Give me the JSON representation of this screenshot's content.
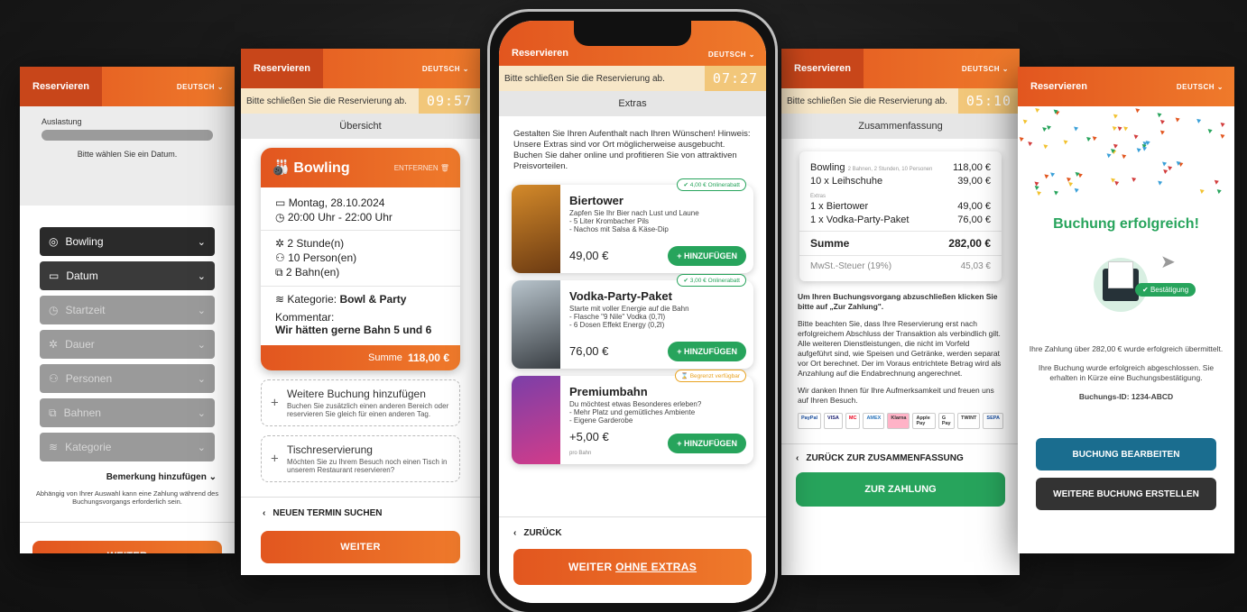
{
  "common": {
    "tab_label": "Reservieren",
    "language": "DEUTSCH",
    "timer_message": "Bitte schließen Sie die Reservierung ab."
  },
  "screen1": {
    "utilization_label": "Auslastung",
    "utilization_hint": "Bitte wählen Sie ein Datum.",
    "selects": [
      "Bowling",
      "Datum",
      "Startzeit",
      "Dauer",
      "Personen",
      "Bahnen",
      "Kategorie"
    ],
    "remark": "Bemerkung hinzufügen",
    "note": "Abhängig von Ihrer Auswahl kann eine Zahlung während des Buchungsvorgangs erforderlich sein.",
    "next": "WEITER"
  },
  "screen2": {
    "timer": "09:57",
    "section": "Übersicht",
    "card_title": "Bowling",
    "remove": "ENTFERNEN",
    "date": "Montag, 28.10.2024",
    "time": "20:00 Uhr - 22:00 Uhr",
    "hours": "2 Stunde(n)",
    "persons": "10 Person(en)",
    "lanes": "2 Bahn(en)",
    "category_label": "Kategorie:",
    "category_value": "Bowl & Party",
    "comment_label": "Kommentar:",
    "comment_value": "Wir hätten gerne Bahn 5 und 6",
    "sum_label": "Summe",
    "sum_value": "118,00 €",
    "add_booking_title": "Weitere Buchung hinzufügen",
    "add_booking_text": "Buchen Sie zusätzlich einen anderen Bereich oder reservieren Sie gleich für einen anderen Tag.",
    "table_title": "Tischreservierung",
    "table_text": "Möchten Sie zu Ihrem Besuch noch einen Tisch in unserem Restaurant reservieren?",
    "back": "NEUEN TERMIN SUCHEN",
    "next": "WEITER"
  },
  "phone": {
    "timer": "07:27",
    "section": "Extras",
    "intro": "Gestalten Sie Ihren Aufenthalt nach Ihren Wünschen! Hinweis: Unsere Extras sind vor Ort möglicherweise ausgebucht. Buchen Sie daher online und profitieren Sie von attraktiven Preisvorteilen.",
    "items": [
      {
        "name": "Biertower",
        "desc": "Zapfen Sie Ihr Bier nach Lust und Laune",
        "l1": "- 5 Liter Krombacher Pils",
        "l2": "- Nachos mit Salsa & Käse-Dip",
        "price": "49,00 €",
        "badge": "4,00 € Onlinerabatt",
        "add": "+ HINZUFÜGEN"
      },
      {
        "name": "Vodka-Party-Paket",
        "desc": "Starte mit voller Energie auf die Bahn",
        "l1": "- Flasche \"9 Nile\" Vodka (0,7l)",
        "l2": "- 6 Dosen Effekt Energy (0,2l)",
        "price": "76,00 €",
        "badge": "3,00 € Onlinerabatt",
        "add": "+ HINZUFÜGEN"
      },
      {
        "name": "Premiumbahn",
        "desc": "Du möchtest etwas Besonderes erleben?",
        "l1": "- Mehr Platz und gemütliches Ambiente",
        "l2": "- Eigene Garderobe",
        "price": "+5,00 €",
        "price_sub": "pro Bahn",
        "badge": "Begrenzt verfügbar",
        "add": "+ HINZUFÜGEN"
      }
    ],
    "back": "ZURÜCK",
    "next_a": "WEITER ",
    "next_b": "OHNE EXTRAS"
  },
  "screen4": {
    "timer": "05:10",
    "section": "Zusammenfassung",
    "bowling_label": "Bowling",
    "bowling_sub": "2 Bahnen, 2 Stunden, 10 Personen",
    "bowling_value": "118,00 €",
    "shoes_label": "10 x Leihschuhe",
    "shoes_value": "39,00 €",
    "extras_label": "Extras",
    "extra1_label": "1 x Biertower",
    "extra1_value": "49,00 €",
    "extra2_label": "1 x Vodka-Party-Paket",
    "extra2_value": "76,00 €",
    "sum_label": "Summe",
    "sum_value": "282,00 €",
    "tax_label": "MwSt.-Steuer (19%)",
    "tax_value": "45,03 €",
    "instruction": "Um Ihren Buchungsvorgang abzuschließen klicken Sie bitte auf „Zur Zahlung\".",
    "notice": "Bitte beachten Sie, dass Ihre Reservierung erst nach erfolgreichem Abschluss der Transaktion als verbindlich gilt. Alle weiteren Dienstleistungen, die nicht im Vorfeld aufgeführt sind, wie Speisen und Getränke, werden separat vor Ort berechnet. Der im Voraus entrichtete Betrag wird als Anzahlung auf die Endabrechnung angerechnet.",
    "thanks": "Wir danken Ihnen für Ihre Aufmerksamkeit und freuen uns auf Ihren Besuch.",
    "payments": [
      "PayPal",
      "VISA",
      "MC",
      "AMEX",
      "Klarna",
      "Apple Pay",
      "G Pay",
      "TWINT",
      "SEPA"
    ],
    "back": "ZURÜCK ZUR ZUSAMMENFASSUNG",
    "pay": "ZUR ZAHLUNG"
  },
  "screen5": {
    "success": "Buchung erfolgreich!",
    "confirm_badge": "Bestätigung",
    "paid": "Ihre Zahlung über 282,00 € wurde erfolgreich übermittelt.",
    "done": "Ihre Buchung wurde erfolgreich abgeschlossen. Sie erhalten in Kürze eine Buchungsbestätigung.",
    "booking_id": "Buchungs-ID: 1234-ABCD",
    "edit": "BUCHUNG BEARBEITEN",
    "new": "WEITERE BUCHUNG ERSTELLEN"
  },
  "colors": {
    "orange": "#e2561f",
    "green": "#27a45c",
    "blue": "#1a6d8f"
  }
}
